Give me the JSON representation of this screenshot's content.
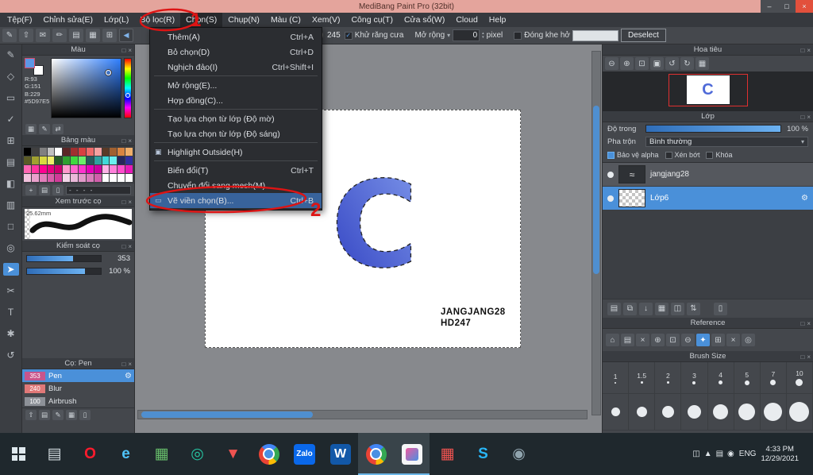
{
  "window": {
    "title": "MediBang Paint Pro (32bit)",
    "minimize": "–",
    "maximize": "□",
    "close": "×"
  },
  "ui": {
    "popout": "□",
    "close": "×",
    "check": "✓",
    "caret": "▾",
    "up": "▴",
    "down": "▾"
  },
  "menu": {
    "items": [
      {
        "label": "Tệp(F)",
        "cls": ""
      },
      {
        "label": "Chỉnh sửa(E)",
        "cls": ""
      },
      {
        "label": "Lớp(L)",
        "cls": ""
      },
      {
        "label": "Bộ lọc(R)",
        "cls": ""
      },
      {
        "label": "Chọn(S)",
        "cls": "active"
      },
      {
        "label": "Chụp(N)",
        "cls": ""
      },
      {
        "label": "Màu (C)",
        "cls": ""
      },
      {
        "label": "Xem(V)",
        "cls": ""
      },
      {
        "label": "Công cụ(T)",
        "cls": ""
      },
      {
        "label": "Cửa sổ(W)",
        "cls": ""
      },
      {
        "label": "Cloud",
        "cls": ""
      },
      {
        "label": "Help",
        "cls": ""
      }
    ]
  },
  "select_menu": {
    "items": [
      {
        "icon": "",
        "label": "Thêm(A)",
        "shortcut": "Ctrl+A",
        "cls": ""
      },
      {
        "icon": "",
        "label": "Bỏ chọn(D)",
        "shortcut": "Ctrl+D",
        "cls": ""
      },
      {
        "icon": "",
        "label": "Nghịch đảo(I)",
        "shortcut": "Ctrl+Shift+I",
        "cls": "sep-after"
      },
      {
        "icon": "",
        "label": "Mở rộng(E)...",
        "shortcut": "",
        "cls": ""
      },
      {
        "icon": "",
        "label": "Hợp đồng(C)...",
        "shortcut": "",
        "cls": "sep-after"
      },
      {
        "icon": "",
        "label": "Tạo lựa chọn từ lớp (Độ mờ)",
        "shortcut": "",
        "cls": ""
      },
      {
        "icon": "",
        "label": "Tạo lựa chọn từ lớp (Độ sáng)",
        "shortcut": "",
        "cls": "sep-after"
      },
      {
        "icon": "▣",
        "label": "Highlight Outside(H)",
        "shortcut": "",
        "cls": "sep-after"
      },
      {
        "icon": "",
        "label": "Biến đổi(T)",
        "shortcut": "Ctrl+T",
        "cls": ""
      },
      {
        "icon": "",
        "label": "Chuyển đổi sang mesh(M)",
        "shortcut": "",
        "cls": ""
      },
      {
        "icon": "▭",
        "label": "Vẽ viền chọn(B)...",
        "shortcut": "Ctrl+B",
        "cls": "highlighted"
      }
    ]
  },
  "toolbar": {
    "left_icons": [
      "✎",
      "⇧",
      "✉",
      "✏",
      "▤",
      "▦",
      "⊞"
    ],
    "back": "◀",
    "brush_value": "245",
    "antialias": "Khử răng cưa",
    "expand": "Mở rộng",
    "expand_value": "0",
    "unit": "pixel",
    "gap": "Đóng khe hở",
    "deselect": "Deselect"
  },
  "tools": {
    "items": [
      {
        "glyph": "✎",
        "cls": ""
      },
      {
        "glyph": "◇",
        "cls": ""
      },
      {
        "glyph": "▭",
        "cls": ""
      },
      {
        "glyph": "✓",
        "cls": ""
      },
      {
        "glyph": "⊞",
        "cls": ""
      },
      {
        "glyph": "▤",
        "cls": ""
      },
      {
        "glyph": "◧",
        "cls": ""
      },
      {
        "glyph": "▥",
        "cls": ""
      },
      {
        "glyph": "□",
        "cls": ""
      },
      {
        "glyph": "◎",
        "cls": ""
      },
      {
        "glyph": "➤",
        "cls": "active"
      },
      {
        "glyph": "✂",
        "cls": ""
      },
      {
        "glyph": "T",
        "cls": ""
      },
      {
        "glyph": "✱",
        "cls": ""
      },
      {
        "glyph": "↺",
        "cls": ""
      }
    ]
  },
  "color_panel": {
    "title": "Màu",
    "r": "R:93",
    "g": "G:151",
    "b": "B:229",
    "hex": "#5D97E5",
    "footer_icons": [
      "▦",
      "✎",
      "⇄"
    ]
  },
  "palette_panel": {
    "title": "Bảng màu",
    "colors": [
      "#000000",
      "#404040",
      "#808080",
      "#c0c0c0",
      "#ffffff",
      "#5b2626",
      "#a03030",
      "#d84040",
      "#ef6a6a",
      "#f5a0a0",
      "#5b3a26",
      "#a06030",
      "#d88440",
      "#efae6a",
      "#5b5b26",
      "#a0a030",
      "#d8d840",
      "#efef6a",
      "#265b26",
      "#30a030",
      "#40d840",
      "#6aef6a",
      "#265b5b",
      "#30a0a0",
      "#40d8d8",
      "#6aefef",
      "#26265b",
      "#3030a0",
      "#ff66b2",
      "#ff33a0",
      "#ff0090",
      "#e60080",
      "#cc0070",
      "#ff99cc",
      "#ff66cc",
      "#ff33cc",
      "#e600b8",
      "#cc00a0",
      "#ffb2e6",
      "#ff80d9",
      "#ff4dcc",
      "#e61ab8",
      "#f2c2dd",
      "#eaa0cc",
      "#e27ebb",
      "#da5caa",
      "#d23a99",
      "#f2d6e8",
      "#eab8d9",
      "#e29aca",
      "#da7cbb",
      "#d25eac",
      "#ffffff",
      "#ffffff",
      "#ffffff",
      "#ffffff"
    ],
    "footer_icons": [
      "+",
      "▤",
      "▯"
    ],
    "footer_label": "- - - -"
  },
  "preview_panel": {
    "title": "Xem trước cọ",
    "size_label": "25.62mm"
  },
  "control_panel": {
    "title": "Kiểm soát cọ",
    "rows": [
      {
        "value": "353",
        "fill": "62%"
      },
      {
        "value": "100 %",
        "fill": "78%"
      }
    ]
  },
  "brush_panel": {
    "title": "Cọ: Pen",
    "brushes": [
      {
        "num": "353",
        "name": "Pen",
        "chip": "#c8558c",
        "cls": "selected",
        "gear": "visible"
      },
      {
        "num": "240",
        "name": "Blur",
        "chip": "#e07878",
        "cls": "",
        "gear": ""
      },
      {
        "num": "100",
        "name": "Airbrush",
        "chip": "#8d9198",
        "cls": "",
        "gear": ""
      }
    ],
    "footer_icons": [
      "⇧",
      "▤",
      "✎",
      "▦",
      "▯"
    ]
  },
  "canvas": {
    "letter": "C",
    "watermark1": "JANGJANG28",
    "watermark2": "HD247"
  },
  "navigator": {
    "title": "Hoa tiêu",
    "tools": [
      "⊖",
      "⊕",
      "⊡",
      "▣",
      "↺",
      "↻",
      "▦"
    ],
    "thumb_letter": "C"
  },
  "layers_panel": {
    "title": "Lớp",
    "opacity_label": "Độ trong",
    "opacity_value": "100 %",
    "blend_label": "Pha trộn",
    "blend_value": "Bình thường",
    "checks": [
      {
        "label": "Bảo vệ alpha",
        "cls": "checked"
      },
      {
        "label": "Xén bớt",
        "cls": ""
      },
      {
        "label": "Khóa",
        "cls": ""
      }
    ],
    "layers": [
      {
        "name": "jangjang28",
        "cls": "",
        "thumb": "paint",
        "gear": ""
      },
      {
        "name": "Lớp6",
        "cls": "selected",
        "thumb": "checker",
        "gear": "visible"
      }
    ],
    "footer_icons": [
      "▤",
      "⧉",
      "↓",
      "▦",
      "◫",
      "⇅"
    ],
    "trash_icon": "▯"
  },
  "reference_panel": {
    "title": "Reference",
    "tools": [
      {
        "glyph": "⌂",
        "cls": ""
      },
      {
        "glyph": "▤",
        "cls": ""
      },
      {
        "glyph": "×",
        "cls": ""
      },
      {
        "glyph": "⊕",
        "cls": ""
      },
      {
        "glyph": "⊡",
        "cls": ""
      },
      {
        "glyph": "⊖",
        "cls": ""
      },
      {
        "glyph": "✦",
        "cls": "active"
      },
      {
        "glyph": "⊞",
        "cls": ""
      },
      {
        "glyph": "×",
        "cls": ""
      },
      {
        "glyph": "◎",
        "cls": ""
      }
    ]
  },
  "brush_size_panel": {
    "title": "Brush Size",
    "row1": [
      {
        "label": "1",
        "dot": "2px"
      },
      {
        "label": "1.5",
        "dot": "3px"
      },
      {
        "label": "2",
        "dot": "3px"
      },
      {
        "label": "3",
        "dot": "4px"
      },
      {
        "label": "4",
        "dot": "5px"
      },
      {
        "label": "5",
        "dot": "6px"
      },
      {
        "label": "7",
        "dot": "7px"
      },
      {
        "label": "10",
        "dot": "9px"
      }
    ],
    "row2": [
      {
        "label": "",
        "dot": "11px"
      },
      {
        "label": "",
        "dot": "13px"
      },
      {
        "label": "",
        "dot": "15px"
      },
      {
        "label": "",
        "dot": "17px"
      },
      {
        "label": "",
        "dot": "19px"
      },
      {
        "label": "",
        "dot": "21px"
      },
      {
        "label": "",
        "dot": "23px"
      },
      {
        "label": "",
        "dot": "25px"
      }
    ]
  },
  "taskbar": {
    "apps": [
      {
        "glyph": "▤",
        "color": "#cfd8dc",
        "bg": "",
        "cls": ""
      },
      {
        "glyph": "O",
        "color": "#ff1b2d",
        "bg": "",
        "cls": "bold"
      },
      {
        "glyph": "e",
        "color": "#4fc3f7",
        "bg": "",
        "cls": "bold"
      },
      {
        "glyph": "▦",
        "color": "#66bb6a",
        "bg": "",
        "cls": ""
      },
      {
        "glyph": "◎",
        "color": "#26c6a2",
        "bg": "",
        "cls": ""
      },
      {
        "glyph": "▼",
        "color": "#ef5350",
        "bg": "",
        "cls": ""
      },
      {
        "glyph": "",
        "color": "",
        "bg": "",
        "cls": "chrome"
      },
      {
        "glyph": "Zalo",
        "color": "#ffffff",
        "bg": "#0a68ea",
        "cls": "zalo"
      },
      {
        "glyph": "W",
        "color": "#ffffff",
        "bg": "#1258a8",
        "cls": "word"
      },
      {
        "glyph": "",
        "color": "",
        "bg": "",
        "cls": "chrome active"
      },
      {
        "glyph": "",
        "color": "",
        "bg": "",
        "cls": "mdp active"
      },
      {
        "glyph": "▦",
        "color": "#ef5350",
        "bg": "",
        "cls": ""
      },
      {
        "glyph": "S",
        "color": "#29b6f6",
        "bg": "",
        "cls": "bold"
      },
      {
        "glyph": "◉",
        "color": "#90a4ae",
        "bg": "",
        "cls": ""
      }
    ],
    "tray_icons": [
      "◫",
      "▲",
      "▤",
      "◉"
    ],
    "lang": "ENG",
    "time": "4:33 PM",
    "date": "12/29/2021"
  },
  "callouts": {
    "one": "1",
    "two": "2"
  }
}
